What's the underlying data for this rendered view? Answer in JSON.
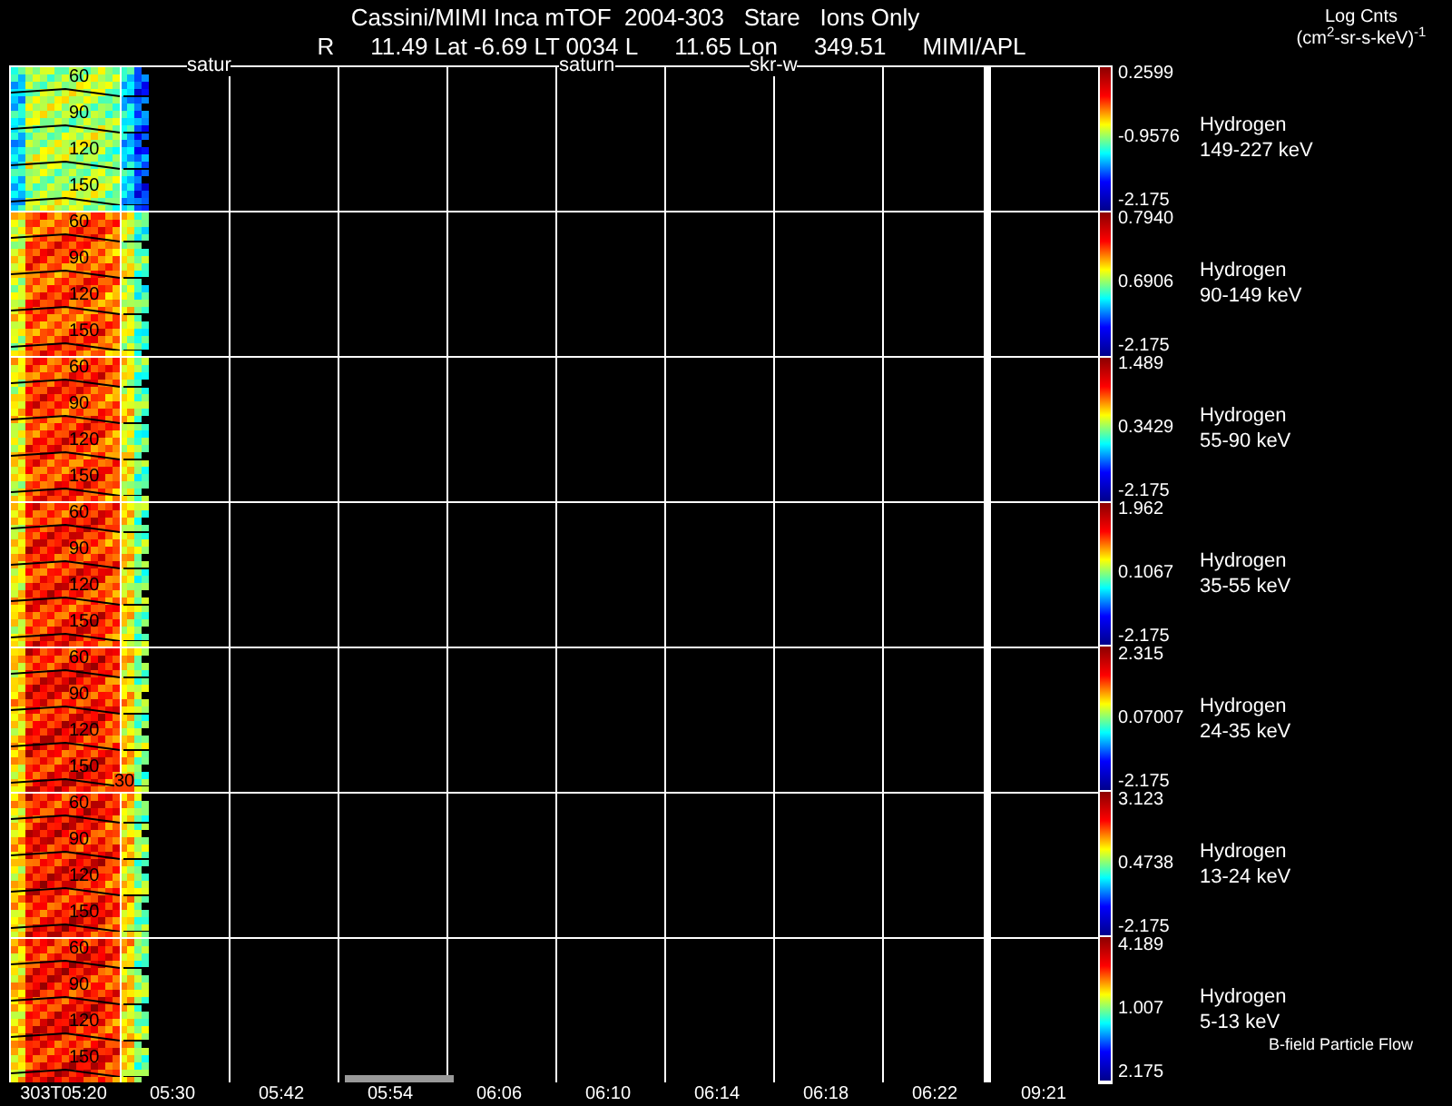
{
  "header": {
    "title": "Cassini/MIMI Inca mTOF  2004-303   Stare   Ions Only",
    "info": [
      "R",
      "11.49 Lat -6.69 LT 0034 L",
      "11.65 Lon",
      "349.51",
      "MIMI/APL"
    ],
    "units_label": "Log Cnts",
    "units": "(cm$^{2}$-sr-s-keV)$^{-1}$"
  },
  "plot_labels": [
    "satur",
    "saturn",
    "skr-w"
  ],
  "panels": [
    {
      "species": "Hydrogen",
      "energy": "149-227 keV",
      "cbar_max": "0.2599",
      "cbar_mid": "-0.9576",
      "cbar_min": "-2.175",
      "angle_labels": [
        "60",
        "90",
        "120",
        "150"
      ]
    },
    {
      "species": "Hydrogen",
      "energy": "90-149 keV",
      "cbar_max": "0.7940",
      "cbar_mid": "0.6906",
      "cbar_min": "-2.175",
      "angle_labels": [
        "60",
        "90",
        "120",
        "150"
      ]
    },
    {
      "species": "Hydrogen",
      "energy": "55-90 keV",
      "cbar_max": "1.489",
      "cbar_mid": "0.3429",
      "cbar_min": "-2.175",
      "angle_labels": [
        "60",
        "90",
        "120",
        "150"
      ]
    },
    {
      "species": "Hydrogen",
      "energy": "35-55 keV",
      "cbar_max": "1.962",
      "cbar_mid": "0.1067",
      "cbar_min": "-2.175",
      "angle_labels": [
        "60",
        "90",
        "120",
        "150"
      ]
    },
    {
      "species": "Hydrogen",
      "energy": "24-35 keV",
      "cbar_max": "2.315",
      "cbar_mid": "0.07007",
      "cbar_min": "-2.175",
      "angle_labels": [
        "60",
        "90",
        "120",
        "150",
        "30"
      ]
    },
    {
      "species": "Hydrogen",
      "energy": "13-24 keV",
      "cbar_max": "3.123",
      "cbar_mid": "0.4738",
      "cbar_min": "-2.175",
      "angle_labels": [
        "60",
        "90",
        "120",
        "150"
      ]
    },
    {
      "species": "Hydrogen",
      "energy": "5-13 keV",
      "cbar_max": "4.189",
      "cbar_mid": "1.007",
      "cbar_min": "2.175",
      "angle_labels": [
        "60",
        "90",
        "120",
        "150"
      ]
    }
  ],
  "time_axis": [
    "303T05:20",
    "05:30",
    "05:42",
    "05:54",
    "06:06",
    "06:10",
    "06:14",
    "06:18",
    "06:22",
    "09:21"
  ],
  "legend_note": "B-field Particle Flow"
}
